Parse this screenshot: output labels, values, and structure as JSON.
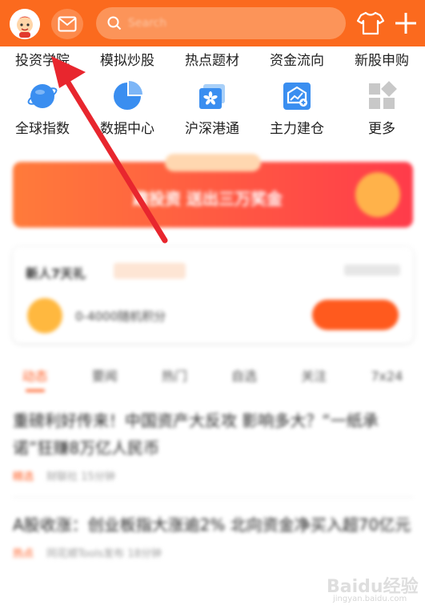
{
  "header": {
    "search_placeholder": "Search",
    "icons": [
      "avatar",
      "mail-icon",
      "search-icon",
      "shirt-icon",
      "plus-icon"
    ],
    "accent": "#fb6a1e"
  },
  "quick_links": [
    "投资学院",
    "模拟炒股",
    "热点题材",
    "资金流向",
    "新股申购"
  ],
  "tools": [
    {
      "label": "全球指数",
      "icon": "globe-icon"
    },
    {
      "label": "数据中心",
      "icon": "pie-chart-icon"
    },
    {
      "label": "沪深港通",
      "icon": "hk-flag-icon"
    },
    {
      "label": "主力建仓",
      "icon": "building-chart-icon"
    },
    {
      "label": "更多",
      "icon": "grid-icon"
    }
  ],
  "banner": {
    "text": "趣投资 送出三万奖金"
  },
  "task_card": {
    "title": "新人7天礼",
    "desc": "0-4000随机积分"
  },
  "feed_tabs": [
    "动态",
    "要闻",
    "热门",
    "自选",
    "关注",
    "7x24"
  ],
  "news": [
    {
      "headline": "重磅利好传来！中国资产大反攻 影响多大？“一纸承诺”狂赚8万亿人民币",
      "source": "精选",
      "meta": "财联社 15分钟"
    },
    {
      "headline": "A股收涨：创业板指大涨逾2% 北向资金净买入超70亿元",
      "source": "热点",
      "meta": "同花顺Tools发布 18分钟"
    }
  ],
  "watermark": {
    "text": "Baidu经验",
    "url": "jingyan.baidu.com"
  }
}
